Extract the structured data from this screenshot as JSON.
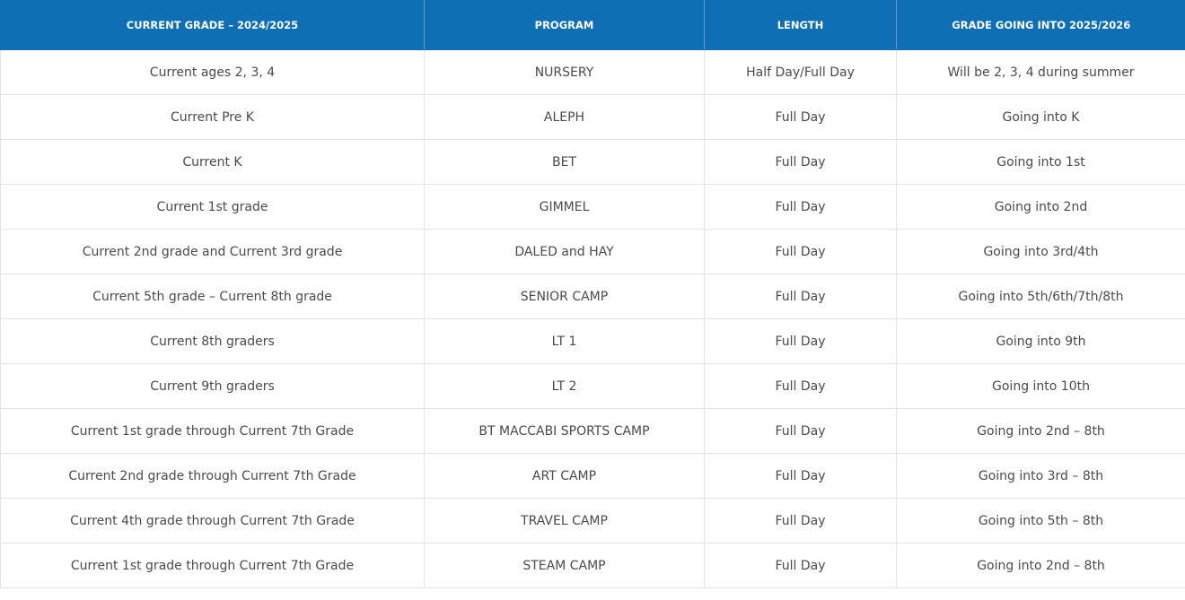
{
  "table": {
    "headers": [
      "CURRENT GRADE – 2024/2025",
      "PROGRAM",
      "LENGTH",
      "GRADE GOING INTO 2025/2026"
    ],
    "rows": [
      [
        "Current ages 2, 3, 4",
        "NURSERY",
        "Half Day/Full Day",
        "Will be 2, 3, 4 during summer"
      ],
      [
        "Current Pre K",
        "ALEPH",
        "Full Day",
        "Going into K"
      ],
      [
        "Current K",
        "BET",
        "Full Day",
        "Going into 1st"
      ],
      [
        "Current 1st grade",
        "GIMMEL",
        "Full Day",
        "Going into 2nd"
      ],
      [
        "Current 2nd grade and Current 3rd grade",
        "DALED and HAY",
        "Full Day",
        "Going into 3rd/4th"
      ],
      [
        "Current 5th grade – Current 8th grade",
        "SENIOR CAMP",
        "Full Day",
        "Going into 5th/6th/7th/8th"
      ],
      [
        "Current 8th graders",
        "LT 1",
        "Full Day",
        "Going into 9th"
      ],
      [
        "Current 9th graders",
        "LT 2",
        "Full Day",
        "Going into 10th"
      ],
      [
        "Current 1st grade through Current 7th Grade",
        "BT MACCABI SPORTS CAMP",
        "Full Day",
        "Going into 2nd – 8th"
      ],
      [
        "Current 2nd grade through Current 7th Grade",
        "ART CAMP",
        "Full Day",
        "Going into 3rd – 8th"
      ],
      [
        "Current 4th grade through Current 7th Grade",
        "TRAVEL CAMP",
        "Full Day",
        "Going into 5th – 8th"
      ],
      [
        "Current 1st grade through Current 7th Grade",
        "STEAM CAMP",
        "Full Day",
        "Going into 2nd – 8th"
      ]
    ]
  },
  "colors": {
    "header_bg": "#0f6fb5",
    "header_text": "#ffffff",
    "body_text": "#4a4a4a",
    "grid": "#e3e3e3"
  }
}
